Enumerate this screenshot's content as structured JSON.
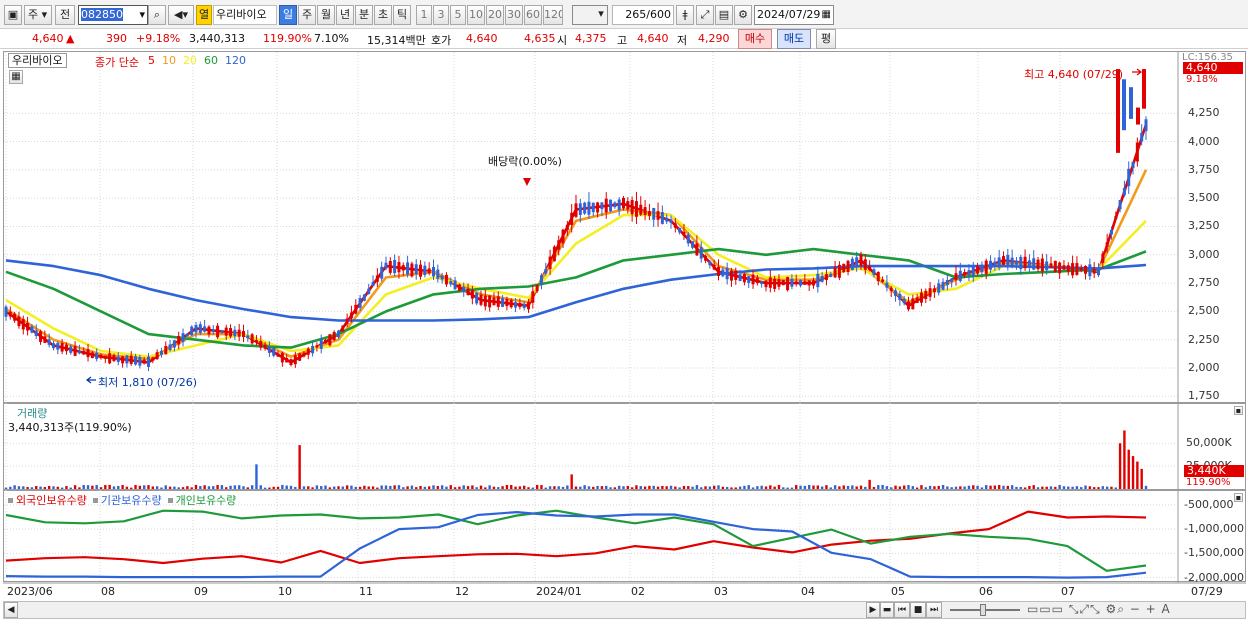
{
  "toolbar": {
    "market": "주",
    "prev_label": "전",
    "code": "082850",
    "stock_name_tag": "열",
    "stock_name": "우리바이오",
    "periods": [
      "일",
      "주",
      "월",
      "년",
      "분",
      "초",
      "틱"
    ],
    "active_period": "일",
    "intervals": [
      "1",
      "3",
      "5",
      "10",
      "20",
      "30",
      "60",
      "120"
    ],
    "count": "265",
    "count_total": "/600",
    "date": "2024/07/29"
  },
  "status": {
    "price": "4,640",
    "change": "390",
    "change_pct": "+9.18%",
    "volume": "3,440,313",
    "volume_ratio": "119.90%",
    "turnover": "7.10%",
    "amount": "15,314백만",
    "quote_label": "호가",
    "ask": "4,640",
    "bid": "4,635",
    "open_label": "시",
    "open": "4,375",
    "high_label": "고",
    "high": "4,640",
    "low_label": "저",
    "low": "4,290",
    "buy_label": "매수",
    "sell_label": "매도",
    "avg_label": "평"
  },
  "price_pane": {
    "name": "우리바이오",
    "legend_label": "종가 단순",
    "ma_periods": [
      "5",
      "10",
      "20",
      "60",
      "120"
    ],
    "ma_colors": [
      "#e00000",
      "#f39a1b",
      "#f3ef22",
      "#1e9a3a",
      "#2f63d8"
    ],
    "y_ticks": [
      "4,250",
      "4,000",
      "3,750",
      "3,500",
      "3,250",
      "3,000",
      "2,750",
      "2,500",
      "2,250",
      "2,000",
      "1,750"
    ],
    "top_label": "LC:156.35",
    "price_tag": "4,640",
    "pct_tag": "9.18%",
    "high_annot": "최고 4,640 (07/29)",
    "low_annot": "최저 1,810 (07/26)",
    "div_annot": "배당락(0.00%)"
  },
  "volume_pane": {
    "title": "거래량",
    "value": "3,440,313주(119.90%)",
    "y_ticks": [
      "50,000K",
      "25,000K"
    ],
    "tag": "3,440K",
    "tag2": "119.90%"
  },
  "holdings_pane": {
    "legend": [
      "외국인보유수량",
      "기관보유수량",
      "개인보유수량"
    ],
    "colors": [
      "#e00000",
      "#2f63d8",
      "#1e9a3a"
    ],
    "y_ticks": [
      "-500,000",
      "-1,000,000",
      "-1,500,000",
      "-2,000,000"
    ]
  },
  "x_axis": [
    "2023/06",
    "08",
    "09",
    "10",
    "11",
    "12",
    "2024/01",
    "02",
    "03",
    "04",
    "05",
    "06",
    "07",
    "07/29"
  ],
  "chart_data": {
    "type": "candlestick",
    "period": "daily",
    "symbol": "082850",
    "name": "우리바이오",
    "last": {
      "close": 4640,
      "open": 4375,
      "high": 4640,
      "low": 4290,
      "change": 390,
      "change_pct": 9.18,
      "volume": 3440313
    },
    "price_range": [
      1750,
      4640
    ],
    "series": [
      {
        "name": "5",
        "values": [
          2500,
          2200,
          2100,
          2050,
          2350,
          2300,
          2050,
          2300,
          2900,
          2850,
          2600,
          2550,
          3400,
          3450,
          3300,
          2850,
          2750,
          2750,
          2950,
          2550,
          2800,
          2950,
          2900,
          2850,
          4150
        ]
      },
      {
        "name": "10",
        "values": [
          2520,
          2250,
          2120,
          2080,
          2300,
          2300,
          2100,
          2250,
          2800,
          2850,
          2650,
          2580,
          3300,
          3400,
          3350,
          2900,
          2780,
          2780,
          2900,
          2580,
          2780,
          2930,
          2900,
          2860,
          3750
        ]
      },
      {
        "name": "20",
        "values": [
          2600,
          2350,
          2150,
          2100,
          2200,
          2300,
          2150,
          2200,
          2650,
          2800,
          2700,
          2620,
          3100,
          3350,
          3350,
          3000,
          2800,
          2820,
          2880,
          2650,
          2700,
          2900,
          2900,
          2870,
          3300
        ]
      },
      {
        "name": "60",
        "values": [
          2850,
          2700,
          2500,
          2300,
          2250,
          2200,
          2180,
          2300,
          2500,
          2650,
          2700,
          2720,
          2800,
          2950,
          3000,
          3050,
          3000,
          3050,
          3000,
          2950,
          2800,
          2830,
          2850,
          2870,
          3030
        ]
      },
      {
        "name": "120",
        "values": [
          2950,
          2900,
          2820,
          2700,
          2600,
          2520,
          2450,
          2420,
          2420,
          2420,
          2430,
          2450,
          2580,
          2700,
          2780,
          2830,
          2870,
          2880,
          2900,
          2900,
          2900,
          2900,
          2890,
          2880,
          2910
        ]
      }
    ]
  }
}
